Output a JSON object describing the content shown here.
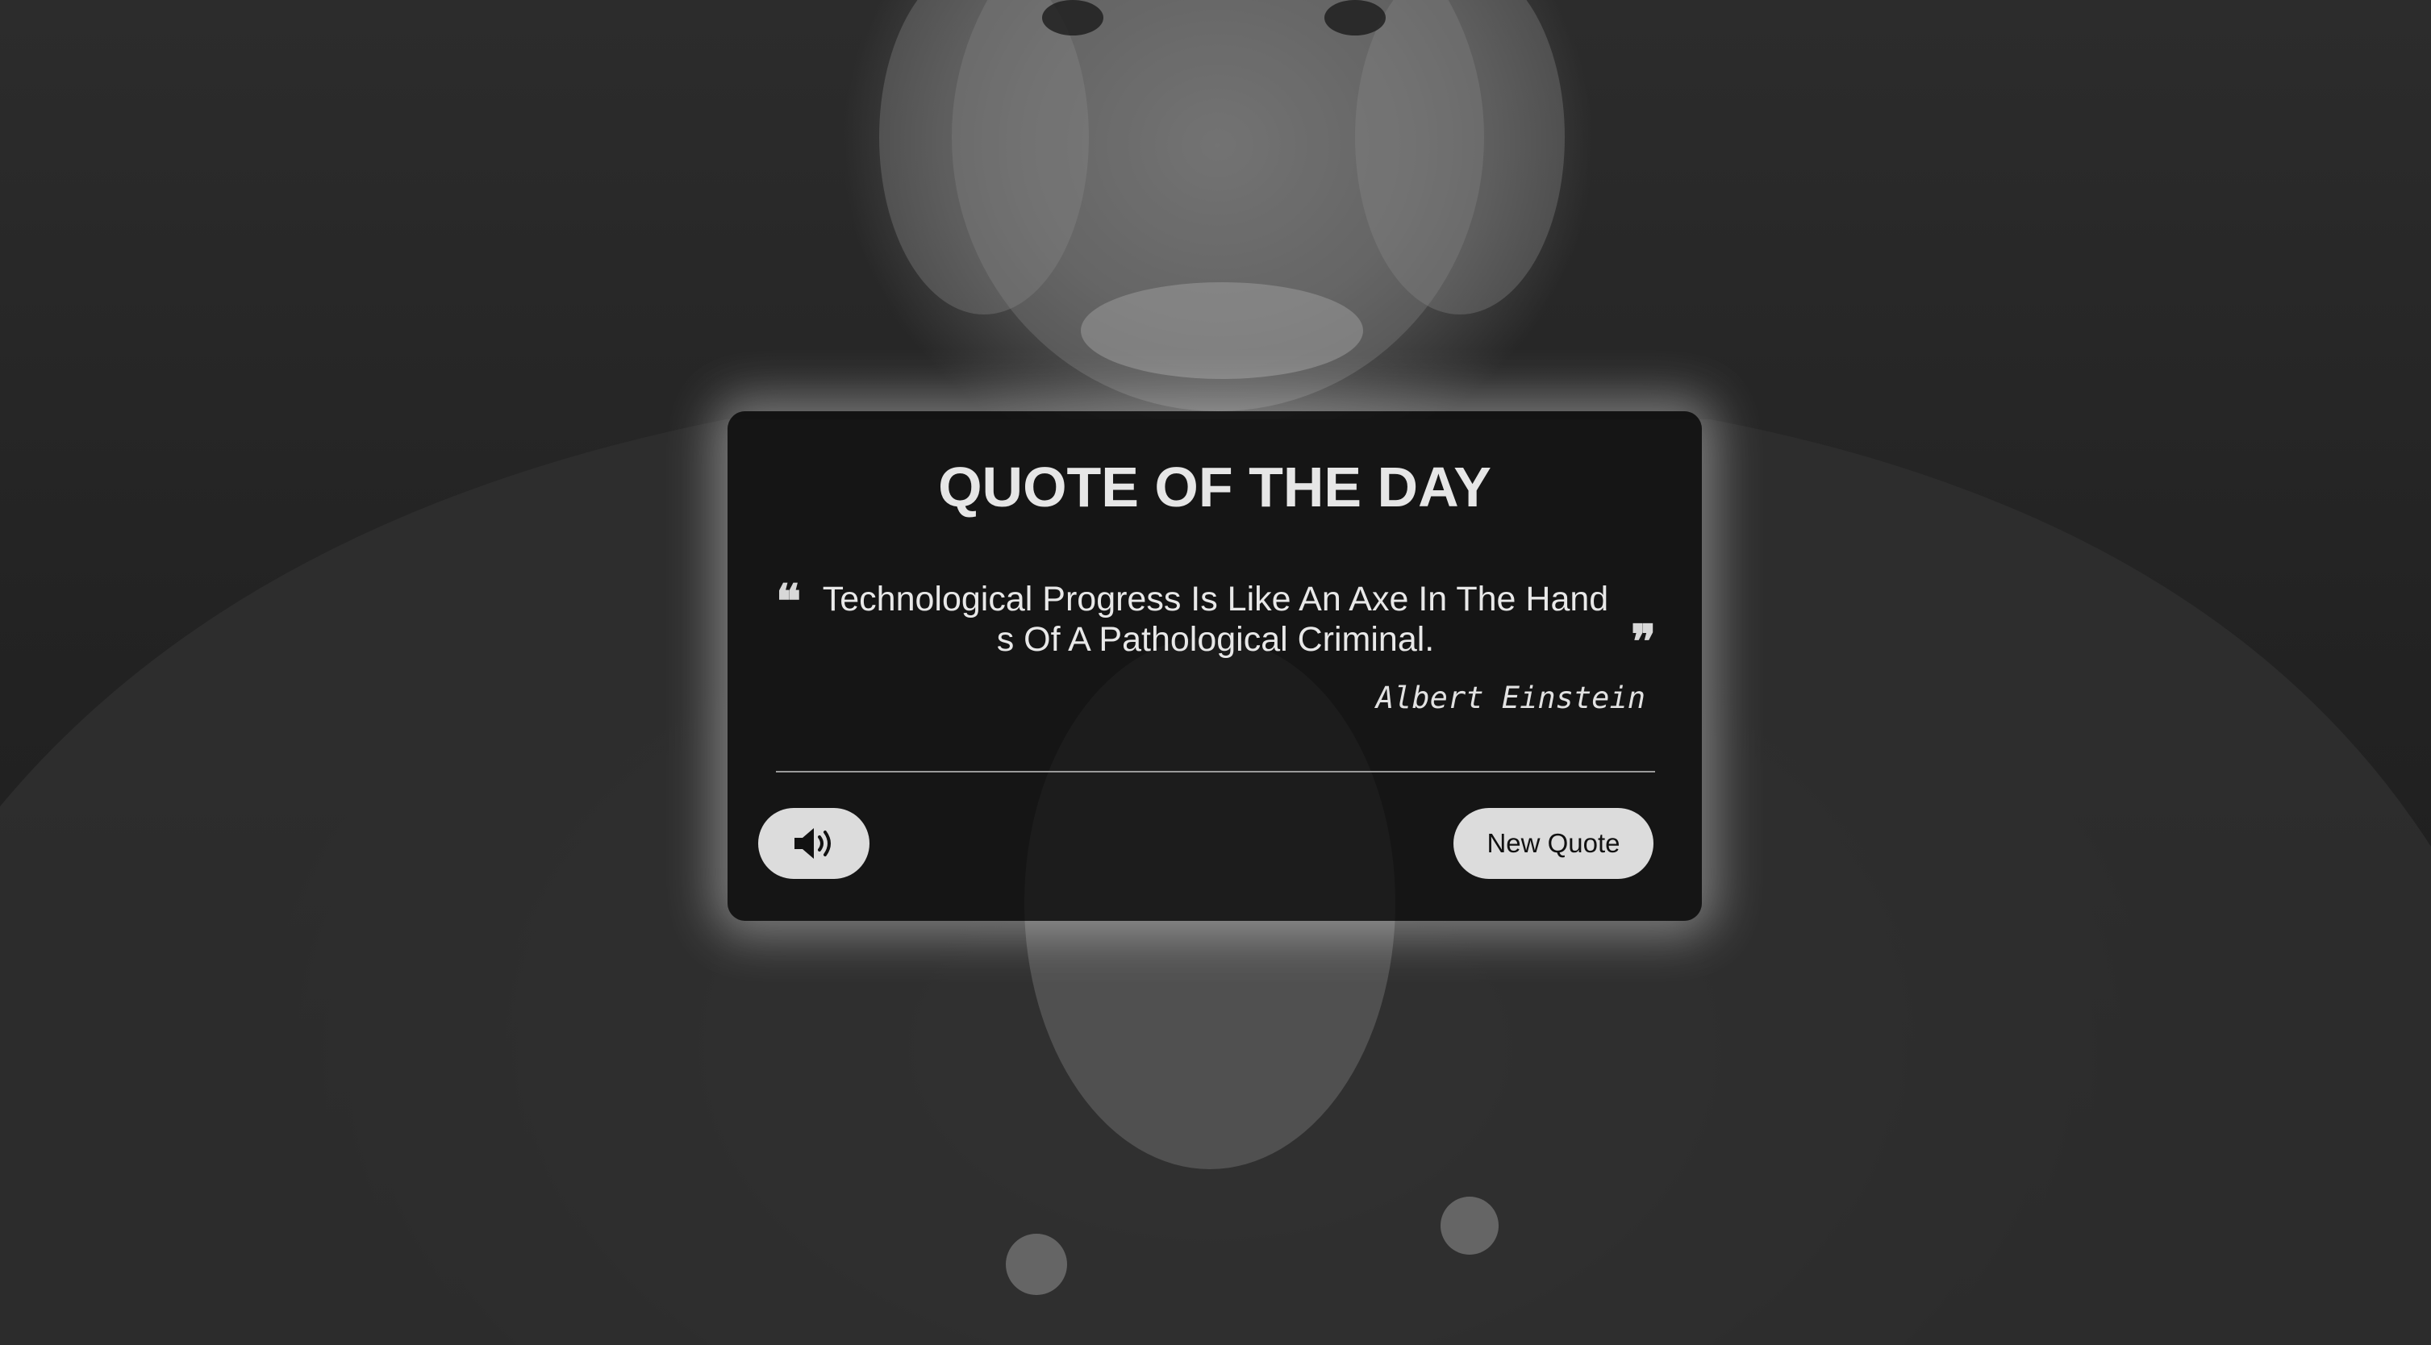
{
  "background": {
    "photo_description_icon": "portrait-photo"
  },
  "card": {
    "title": "QUOTE OF THE DAY",
    "quote_text": "Technological Progress Is Like An Axe In The Hands Of A Pathological Criminal.",
    "author": "Albert Einstein",
    "open_quote_glyph": "❝",
    "close_quote_glyph": "❞",
    "speak_button_icon": "volume-icon",
    "new_quote_label": "New Quote"
  },
  "colors": {
    "card_background": "#0e0e0e",
    "button_background": "#dcdcdc",
    "text_light": "#e8e8e8"
  }
}
